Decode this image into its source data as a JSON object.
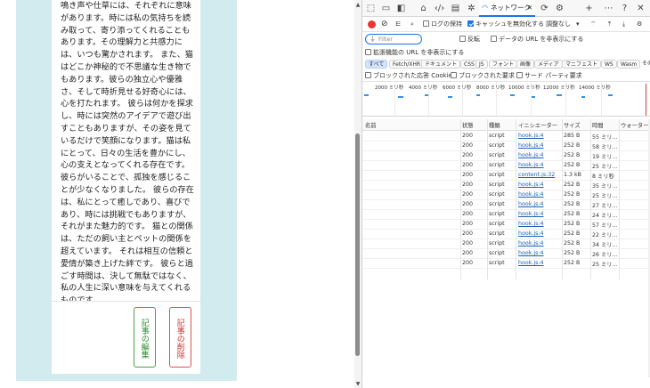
{
  "article": {
    "text": "鳴き声や仕草には、それぞれに意味があります。時には私の気持ちを読み取って、寄り添ってくれることもあります。その理解力と共感力には、いつも驚かされます。 また、猫はどこか神秘的で不思議な生き物でもあります。彼らの独立心や優雅さ、そして時折見せる好奇心には、心を打たれます。 彼らは何かを探求し、時には突然のアイデアで遊び出すこともありますが、その姿を見ているだけで笑顔になります。猫は私にとって、日々の生活を豊かにし、心の支えとなってくれる存在です。 彼らがいることで、孤独を感じることが少なくなりました。 彼らの存在は、私にとって癒しであり、喜びであり、時には挑戦でもありますが、それがまた魅力的です。 猫との関係は、ただの飼い主とペットの関係を超えています。 それは相互の信頼と愛情が築き上げた絆です。 彼らと過ごす時間は、決して無駄ではなく、私の人生に深い意味を与えてくれるものです。"
  },
  "buttons": {
    "edit": "記事の編集",
    "delete": "記事の削除"
  },
  "devtools": {
    "network_tab": "ネットワーク",
    "toolbar": {
      "preserve_log": "ログの保持",
      "disable_cache": "キャッシュを無効化する",
      "throttle": "調整なし"
    },
    "filter": {
      "placeholder": "Filter",
      "invert": "反転",
      "hide_data_urls": "データの URL を非表示にする",
      "hide_ext_urls": "拡張機能の URL を非表示にする"
    },
    "types": [
      "すべて",
      "Fetch/XHR",
      "ドキュメント",
      "CSS",
      "JS",
      "フォント",
      "画像",
      "メディア",
      "マニフェスト",
      "WS",
      "Wasm",
      "その"
    ],
    "blocking": {
      "blocked_cookies": "ブロックされた応答 Cookie",
      "blocked_requests": "ブロックされた要求",
      "third_party": "サード パーティ要求"
    },
    "timeline_ticks": [
      "2000 ミリ秒",
      "4000 ミリ秒",
      "6000 ミリ秒",
      "8000 ミリ秒",
      "10000 ミリ秒",
      "12000 ミリ秒",
      "14000 ミリ秒"
    ],
    "columns": {
      "name": "名前",
      "status": "状態",
      "type": "種類",
      "initiator": "イニシエーター",
      "size": "サイズ",
      "time": "時間",
      "waterfall": "ウォーターフォール"
    },
    "rows": [
      {
        "name": "dh?bh=HQsAvC3qQdk6eLKBU...",
        "status": "200",
        "type": "script",
        "initiator": "hook.js:4",
        "size": "285 B",
        "time": "55 ミリ..."
      },
      {
        "name": "hook.js?BEEFHOOK=HQsAvC3q...",
        "status": "200",
        "type": "script",
        "initiator": "hook.js:4",
        "size": "252 B",
        "time": "58 ミリ..."
      },
      {
        "name": "hook.js?BEEFHOOK=HQsAvC3q...",
        "status": "200",
        "type": "script",
        "initiator": "hook.js:4",
        "size": "252 B",
        "time": "19 ミリ..."
      },
      {
        "name": "hook.js?BEEFHOOK=HQsAvC3q...",
        "status": "200",
        "type": "script",
        "initiator": "hook.js:4",
        "size": "252 B",
        "time": "25 ミリ..."
      },
      {
        "name": "js.js",
        "status": "200",
        "type": "script",
        "initiator": "content.js:32",
        "size": "1.3 kB",
        "time": "8 ミリ秒"
      },
      {
        "name": "hook.js?BEEFHOOK=HQsAvC3q...",
        "status": "200",
        "type": "script",
        "initiator": "hook.js:4",
        "size": "252 B",
        "time": "35 ミリ..."
      },
      {
        "name": "hook.js?BEEFHOOK=HQsAvC3q...",
        "status": "200",
        "type": "script",
        "initiator": "hook.js:4",
        "size": "252 B",
        "time": "25 ミリ..."
      },
      {
        "name": "hook.js?BEEFHOOK=HQsAvC3q...",
        "status": "200",
        "type": "script",
        "initiator": "hook.js:4",
        "size": "252 B",
        "time": "27 ミリ..."
      },
      {
        "name": "hook.js?BEEFHOOK=HQsAvC3q...",
        "status": "200",
        "type": "script",
        "initiator": "hook.js:4",
        "size": "252 B",
        "time": "24 ミリ..."
      },
      {
        "name": "hook.js?BEEFHOOK=HQsAvC3q...",
        "status": "200",
        "type": "script",
        "initiator": "hook.js:4",
        "size": "252 B",
        "time": "57 ミリ..."
      },
      {
        "name": "hook.js?BEEFHOOK=HQsAvC3q...",
        "status": "200",
        "type": "script",
        "initiator": "hook.js:4",
        "size": "252 B",
        "time": "22 ミリ..."
      },
      {
        "name": "hook.js?BEEFHOOK=HQsAvC3q...",
        "status": "200",
        "type": "script",
        "initiator": "hook.js:4",
        "size": "252 B",
        "time": "34 ミリ..."
      },
      {
        "name": "hook.js?BEEFHOOK=HQsAvC3q...",
        "status": "200",
        "type": "script",
        "initiator": "hook.js:4",
        "size": "252 B",
        "time": "26 ミリ..."
      },
      {
        "name": "hook.js?BEEFHOOK=HQsAvC3q...",
        "status": "200",
        "type": "script",
        "initiator": "hook.js:4",
        "size": "252 B",
        "time": "25 ミリ..."
      }
    ]
  }
}
